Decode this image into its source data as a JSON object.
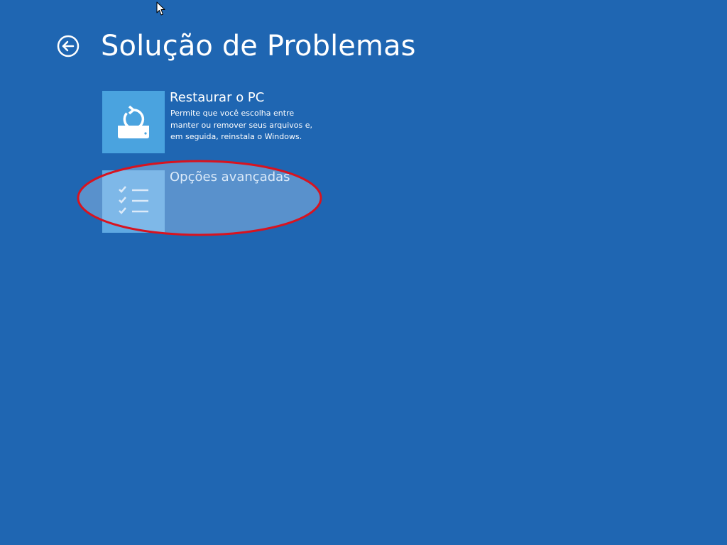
{
  "header": {
    "title": "Solução de Problemas",
    "back_icon": "back-arrow-circle-icon"
  },
  "tiles": [
    {
      "title": "Restaurar o PC",
      "description": "Permite que você escolha entre manter ou remover seus arquivos e, em seguida, reinstala o Windows.",
      "icon": "reset-pc-icon"
    },
    {
      "title": "Opções avançadas",
      "description": "",
      "icon": "checklist-icon"
    }
  ],
  "annotation": {
    "highlight_color": "#d8131f",
    "highlighted_tile": "Opções avançadas"
  },
  "colors": {
    "background": "#1f66b2",
    "tile_icon_background": "#4aa3df",
    "text": "#ffffff"
  }
}
